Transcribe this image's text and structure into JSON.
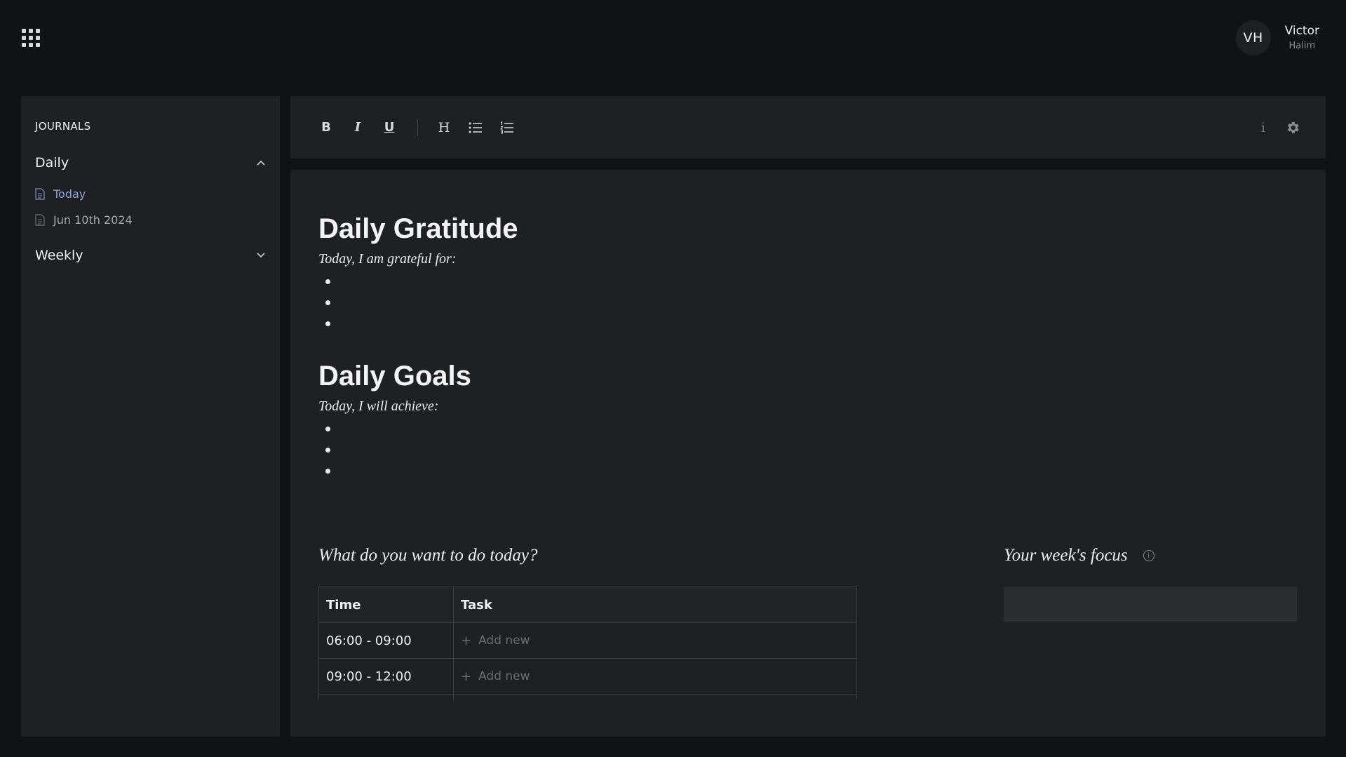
{
  "user": {
    "initials": "VH",
    "first_name": "Victor",
    "last_name": "Halim"
  },
  "sidebar": {
    "title": "JOURNALS",
    "sections": [
      {
        "label": "Daily",
        "expanded": true,
        "items": [
          {
            "label": "Today",
            "active": true
          },
          {
            "label": "Jun 10th 2024",
            "active": false
          }
        ]
      },
      {
        "label": "Weekly",
        "expanded": false
      }
    ]
  },
  "toolbar": {
    "bold": "B",
    "italic": "I",
    "underline": "U",
    "heading": "H",
    "info": "i"
  },
  "editor": {
    "gratitude": {
      "title": "Daily Gratitude",
      "prompt": "Today, I am grateful for:"
    },
    "goals": {
      "title": "Daily Goals",
      "prompt": "Today, I will achieve:"
    },
    "schedule": {
      "title": "What do you want to do today?",
      "headers": {
        "time": "Time",
        "task": "Task"
      },
      "rows": [
        {
          "time": "06:00 - 09:00",
          "task_placeholder": "Add new"
        },
        {
          "time": "09:00 - 12:00",
          "task_placeholder": "Add new"
        },
        {
          "time": "",
          "task_placeholder": ""
        }
      ]
    },
    "focus": {
      "title": "Your week's focus",
      "info": "i"
    }
  },
  "colors": {
    "background": "#111216",
    "panel": "#1f2023",
    "active_link": "#8ea0d8"
  },
  "icons": [
    "apps-grid-icon",
    "chevron-up-icon",
    "chevron-down-icon",
    "document-icon",
    "bold-icon",
    "italic-icon",
    "underline-icon",
    "heading-icon",
    "bullet-list-icon",
    "numbered-list-icon",
    "info-icon",
    "gear-icon",
    "plus-icon"
  ]
}
